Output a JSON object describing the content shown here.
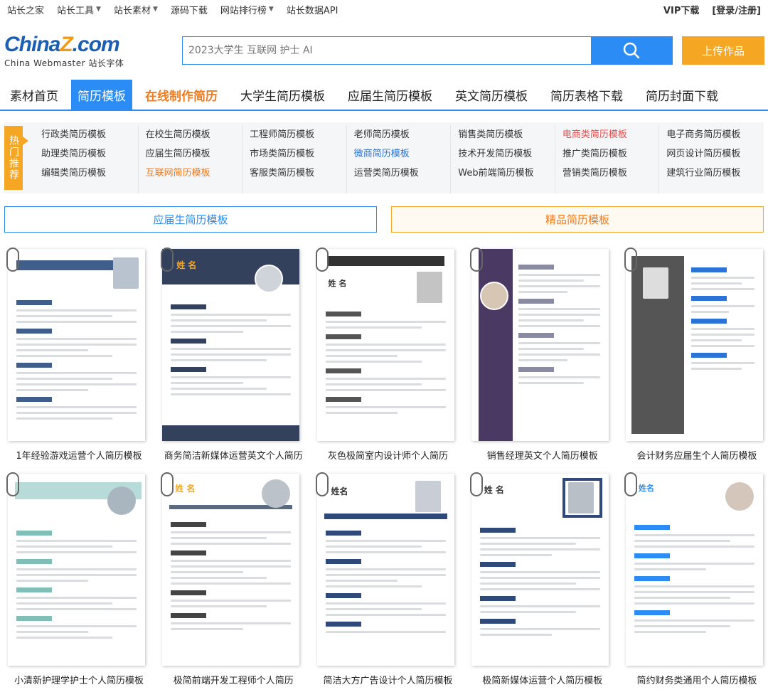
{
  "topbar": {
    "links": [
      "站长之家",
      "站长工具",
      "站长素材",
      "源码下载",
      "网站排行榜",
      "站长数据API"
    ],
    "vip": "VIP下载",
    "login": "[登录/注册]"
  },
  "logo": {
    "brand_a": "China",
    "brand_z": "Z",
    "brand_b": ".com",
    "sub": "China Webmaster 站长字体"
  },
  "search": {
    "placeholder": "2023大学生 互联网 护士 AI",
    "upload_label": "上传作品"
  },
  "nav": [
    "素材首页",
    "简历模板",
    "在线制作简历",
    "大学生简历模板",
    "应届生简历模板",
    "英文简历模板",
    "简历表格下载",
    "简历封面下载"
  ],
  "hot": {
    "tag": "热门推荐",
    "columns": [
      [
        "行政类简历模板",
        "助理类简历模板",
        "编辑类简历模板"
      ],
      [
        "在校生简历模板",
        "应届生简历模板",
        "互联网简历模板"
      ],
      [
        "工程师简历模板",
        "市场类简历模板",
        "客服类简历模板"
      ],
      [
        "老师简历模板",
        "微商简历模板",
        "运营类简历模板"
      ],
      [
        "销售类简历模板",
        "技术开发简历模板",
        "Web前端简历模板"
      ],
      [
        "电商类简历模板",
        "推广类简历模板",
        "营销类简历模板"
      ],
      [
        "电子商务简历模板",
        "网页设计简历模板",
        "建筑行业简历模板"
      ]
    ]
  },
  "switch": {
    "left": "应届生简历模板",
    "right": "精品简历模板"
  },
  "cards": [
    "1年经验游戏运营个人简历模板",
    "商务简洁新媒体运营英文个人简历",
    "灰色极简室内设计师个人简历",
    "销售经理英文个人简历模板",
    "会计财务应届生个人简历模板",
    "小清新护理学护士个人简历模板",
    "极简前端开发工程师个人简历",
    "简洁大方广告设计个人简历模板",
    "极简新媒体运营个人简历模板",
    "简约财务类通用个人简历模板"
  ],
  "colors": {
    "accent": "#2b8cf6",
    "orange": "#f5a623",
    "hot_text": "#f07a1e"
  }
}
